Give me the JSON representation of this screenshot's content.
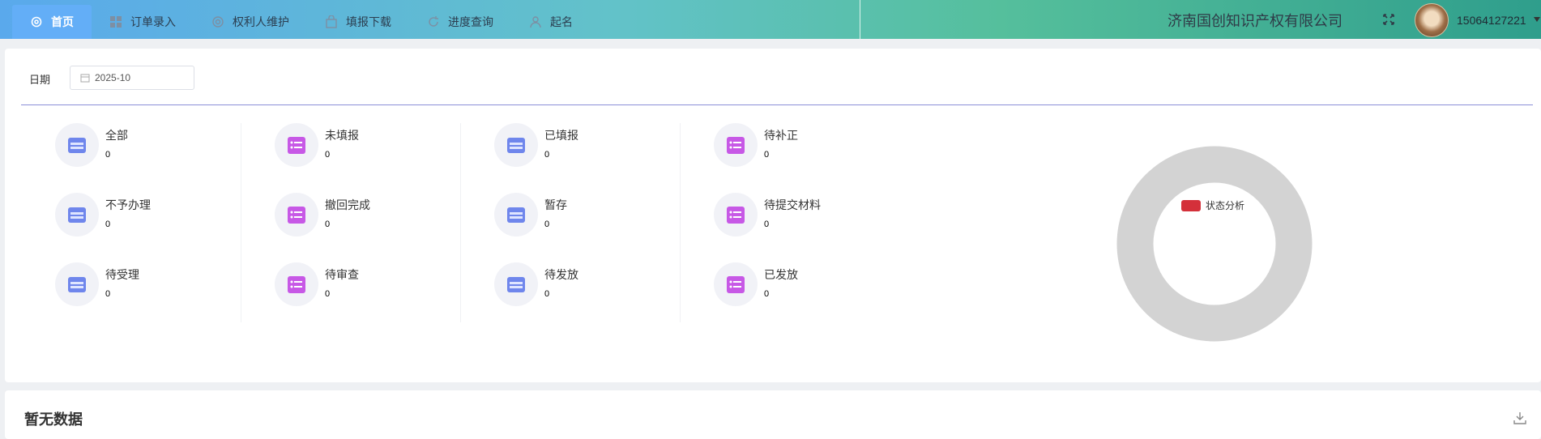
{
  "nav": {
    "items": [
      {
        "label": "首页",
        "icon": "gear-icon",
        "active": true
      },
      {
        "label": "订单录入",
        "icon": "grid-icon"
      },
      {
        "label": "权利人维护",
        "icon": "at-icon"
      },
      {
        "label": "填报下载",
        "icon": "bag-icon"
      },
      {
        "label": "进度查询",
        "icon": "refresh-icon"
      },
      {
        "label": "起名",
        "icon": "user-icon"
      }
    ]
  },
  "header": {
    "company": "济南国创知识产权有限公司",
    "username": "15064127221"
  },
  "filter": {
    "date_label": "日期",
    "date_value": "2025-10"
  },
  "stats": [
    {
      "label": "全部",
      "value": "0",
      "style": "blue"
    },
    {
      "label": "未填报",
      "value": "0",
      "style": "purple"
    },
    {
      "label": "已填报",
      "value": "0",
      "style": "blue"
    },
    {
      "label": "待补正",
      "value": "0",
      "style": "purple"
    },
    {
      "label": "不予办理",
      "value": "0",
      "style": "blue"
    },
    {
      "label": "撤回完成",
      "value": "0",
      "style": "purple"
    },
    {
      "label": "暂存",
      "value": "0",
      "style": "blue"
    },
    {
      "label": "待提交材料",
      "value": "0",
      "style": "purple"
    },
    {
      "label": "待受理",
      "value": "0",
      "style": "blue"
    },
    {
      "label": "待审查",
      "value": "0",
      "style": "purple"
    },
    {
      "label": "待发放",
      "value": "0",
      "style": "blue"
    },
    {
      "label": "已发放",
      "value": "0",
      "style": "purple"
    }
  ],
  "chart": {
    "legend_label": "状态分析",
    "legend_color": "#d4303a",
    "ring_color": "#d3d3d3"
  },
  "table": {
    "empty_title": "暂无数据"
  },
  "colors": {
    "active_tab": "#63aef7",
    "accent_line": "#8b8fd8"
  }
}
